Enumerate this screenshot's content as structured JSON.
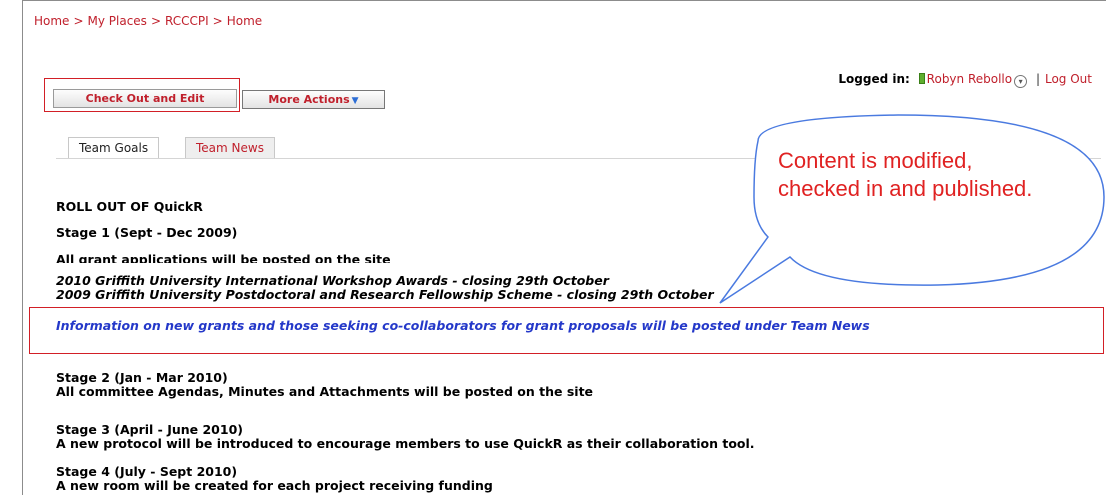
{
  "breadcrumb": {
    "items": [
      "Home",
      "My Places",
      "RCCCPI",
      "Home"
    ],
    "separator": ">"
  },
  "login": {
    "label": "Logged in:",
    "user": "Robyn Rebollo",
    "separator": "|",
    "logout": "Log Out"
  },
  "toolbar": {
    "checkout_label": "Check Out and Edit",
    "more_label": "More Actions",
    "more_caret": "▼"
  },
  "tabs": [
    {
      "label": "Team Goals",
      "active": true
    },
    {
      "label": "Team News",
      "active": false
    }
  ],
  "callout": {
    "line1": "Content is modified,",
    "line2": "checked in and published."
  },
  "content": {
    "heading": "ROLL OUT OF QuickR",
    "stage1_title": "Stage 1 (Sept - Dec 2009)",
    "stage1_desc": "All grant applications will be posted on the site",
    "grant1": "2010 Griffith University International Workshop Awards - closing 29th October",
    "grant2": "2009 Griffith University Postdoctoral and Research Fellowship Scheme - closing 29th October",
    "info": "Information on new grants and those seeking co-collaborators for grant proposals will be posted under Team News",
    "stage2_title": "Stage 2 (Jan - Mar 2010)",
    "stage2_desc": "All committee Agendas, Minutes and Attachments will be posted on the site",
    "stage3_title": "Stage 3 (April - June 2010)",
    "stage3_desc": "A new protocol will be introduced to encourage members to use QuickR as their collaboration tool.",
    "stage4_title": "Stage 4 (July - Sept 2010)",
    "stage4_desc": "A new room will be created for each project receiving funding"
  },
  "colors": {
    "link_red": "#c0202c",
    "info_blue": "#2438c9",
    "highlight_red": "#d21f26",
    "callout_stroke": "#4a7ae0",
    "callout_text": "#e02222"
  },
  "icons": [
    "presence-icon",
    "user-menu-chevron-icon",
    "dropdown-caret-icon"
  ]
}
